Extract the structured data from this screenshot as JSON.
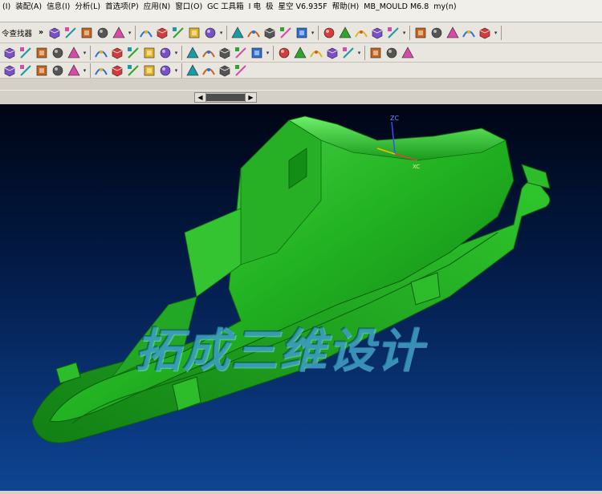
{
  "menubar": {
    "items": [
      "(I)",
      "装配(A)",
      "信息(I)",
      "分析(L)",
      "首选项(P)",
      "应用(N)",
      "窗口(O)",
      "GC 工具箱",
      "I 电",
      "极",
      "星空 V6.935F",
      "帮助(H)",
      "MB_MOULD M6.8",
      "my(n)"
    ]
  },
  "toolbar": {
    "command_finder_label": "令查找器",
    "more_glyph": "»"
  },
  "icons": {
    "row1": [
      "translate-icon",
      "surface-shade-icon",
      "solid-block-icon",
      "sphere-icon",
      "cube-view-icon",
      "render-toggle-icon",
      "box-edit-icon",
      "box-front-icon",
      "box-side-icon",
      "display-style-icon",
      "view-orient-icon",
      "view-orient-2-icon",
      "view-orient-3-icon",
      "red-box-icon",
      "blue-cube-icon",
      "cone-icon",
      "yellow-sphere-icon",
      "pyramid-icon",
      "fence-icon",
      "split-line-icon",
      "arrow-curve-icon",
      "trim-curve-icon",
      "flag-icon",
      "swirl-icon",
      "mesh-icon"
    ],
    "row2": [
      "layer-manager-icon",
      "sketch-icon",
      "extrude-icon",
      "sweep-icon",
      "revolve-icon",
      "hole-icon",
      "datum-icon",
      "offset-face-icon",
      "blend-icon",
      "curve-icon",
      "spline-icon",
      "bridge-curve-icon",
      "wave-curve-icon",
      "sew-icon",
      "thicken-icon",
      "face-blend-icon",
      "project-icon",
      "swept-face-icon",
      "mold-part-icon",
      "color-face-icon",
      "move-face-icon",
      "zoom-icon",
      "delete-face-icon"
    ],
    "row3": [
      "snap-end-icon",
      "snap-mid-icon",
      "undo-icon",
      "redo-icon",
      "box-select-icon",
      "point-dots-icon",
      "line-tool-icon",
      "arc-tool-icon",
      "circle-tool-icon",
      "plus-tool-icon",
      "snap-circle-icon",
      "diagonal-line-icon",
      "rotate-view-icon",
      "cube-small-icon"
    ]
  },
  "viewport": {
    "watermark": "拓成三维设计",
    "wcs_label": "ZC",
    "axis_label": "XC"
  },
  "colors": {
    "part": "#1fb71f",
    "background_top": "#000513",
    "background_bottom": "#0e4693"
  }
}
